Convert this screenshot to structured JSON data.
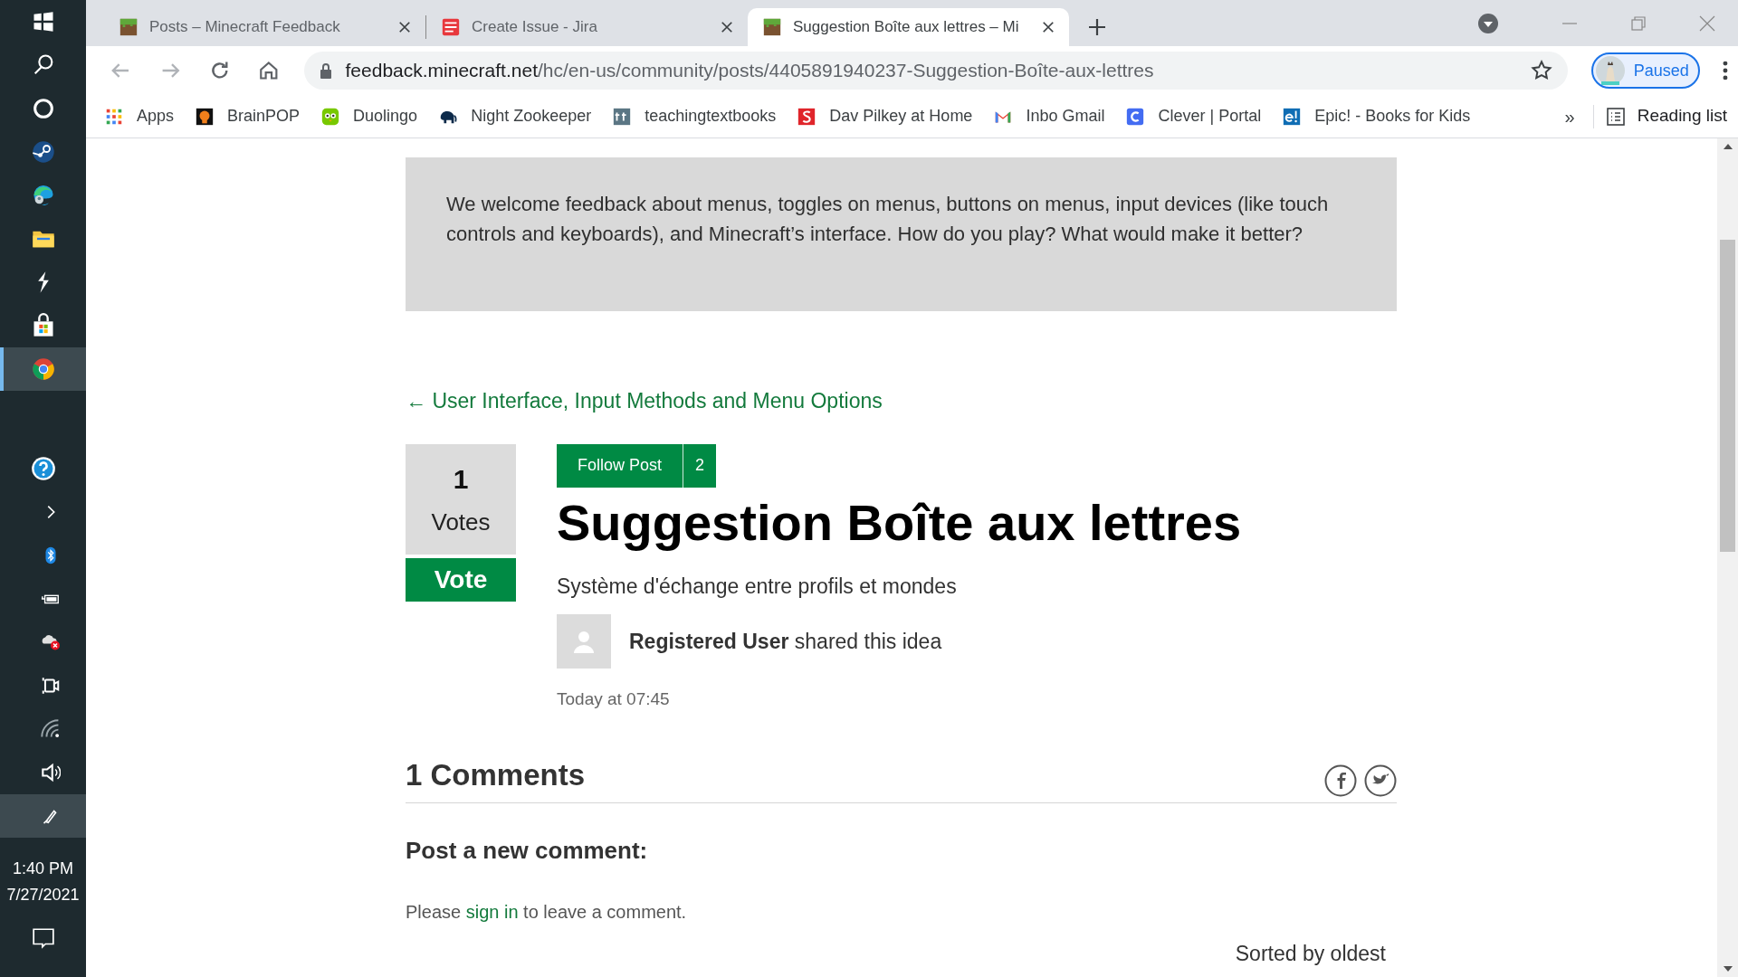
{
  "taskbar": {
    "apps": [
      {
        "kind": "windows",
        "selected": false
      },
      {
        "kind": "search",
        "selected": false
      },
      {
        "kind": "cortana",
        "selected": false
      },
      {
        "kind": "steam",
        "selected": false
      },
      {
        "kind": "edge",
        "selected": false
      },
      {
        "kind": "folder",
        "selected": false
      },
      {
        "kind": "bolt",
        "selected": false
      },
      {
        "kind": "store",
        "selected": false
      },
      {
        "kind": "chrome",
        "selected": true
      }
    ],
    "tray": [
      {
        "kind": "help",
        "selected": false
      },
      {
        "kind": "chevron",
        "selected": false
      },
      {
        "kind": "bluetooth",
        "selected": false
      },
      {
        "kind": "battery",
        "selected": false
      },
      {
        "kind": "cloud",
        "selected": false
      },
      {
        "kind": "camera",
        "selected": false
      },
      {
        "kind": "wifi",
        "selected": false
      },
      {
        "kind": "volume",
        "selected": false
      },
      {
        "kind": "pen",
        "selected": true
      }
    ],
    "time": "1:40 PM",
    "date": "7/27/2021"
  },
  "tabs": [
    {
      "title": "Posts – Minecraft Feedback",
      "kind": "grass",
      "selected": false
    },
    {
      "title": "Create Issue - Jira",
      "kind": "mojang",
      "selected": false
    },
    {
      "title": "Suggestion Boîte aux lettres – Mi",
      "kind": "grass",
      "selected": true
    }
  ],
  "address": {
    "host": "feedback.minecraft.net",
    "path": "/hc/en-us/community/posts/4405891940237-Suggestion-Boîte-aux-lettres"
  },
  "profile": {
    "label": "Paused"
  },
  "bookmarks": [
    {
      "label": "Apps",
      "kind": "apps"
    },
    {
      "label": "BrainPOP",
      "kind": "brainpop"
    },
    {
      "label": "Duolingo",
      "kind": "duolingo"
    },
    {
      "label": "Night Zookeeper",
      "kind": "elephant"
    },
    {
      "label": "teachingtextbooks",
      "kind": "tt"
    },
    {
      "label": "Dav Pilkey at Home",
      "kind": "s"
    },
    {
      "label": "Inbo Gmail",
      "kind": "gmail"
    },
    {
      "label": "Clever | Portal",
      "kind": "clever"
    },
    {
      "label": "Epic! - Books for Kids",
      "kind": "epic"
    }
  ],
  "overflow": "»",
  "reading_list": "Reading list",
  "page": {
    "intro": "We welcome feedback about menus, toggles on menus, buttons on menus, input devices (like touch controls and keyboards), and Minecraft’s interface. How do you play? What would make it better?",
    "back_link": "← User Interface, Input Methods and Menu Options",
    "votes": {
      "count": "1",
      "label": "Votes",
      "button": "Vote"
    },
    "follow": {
      "label": "Follow Post",
      "count": "2"
    },
    "title": "Suggestion Boîte aux lettres",
    "subtitle": "Système d'échange entre profils et mondes",
    "author": "**Registered User** shared this idea",
    "time": "Today at 07:45",
    "comments_heading": "1 Comments",
    "new_comment_heading": "Post a new comment:",
    "sign_in": {
      "before": "Please ",
      "link": "sign in",
      "after": " to leave a comment."
    },
    "sort": "Sorted by oldest"
  }
}
